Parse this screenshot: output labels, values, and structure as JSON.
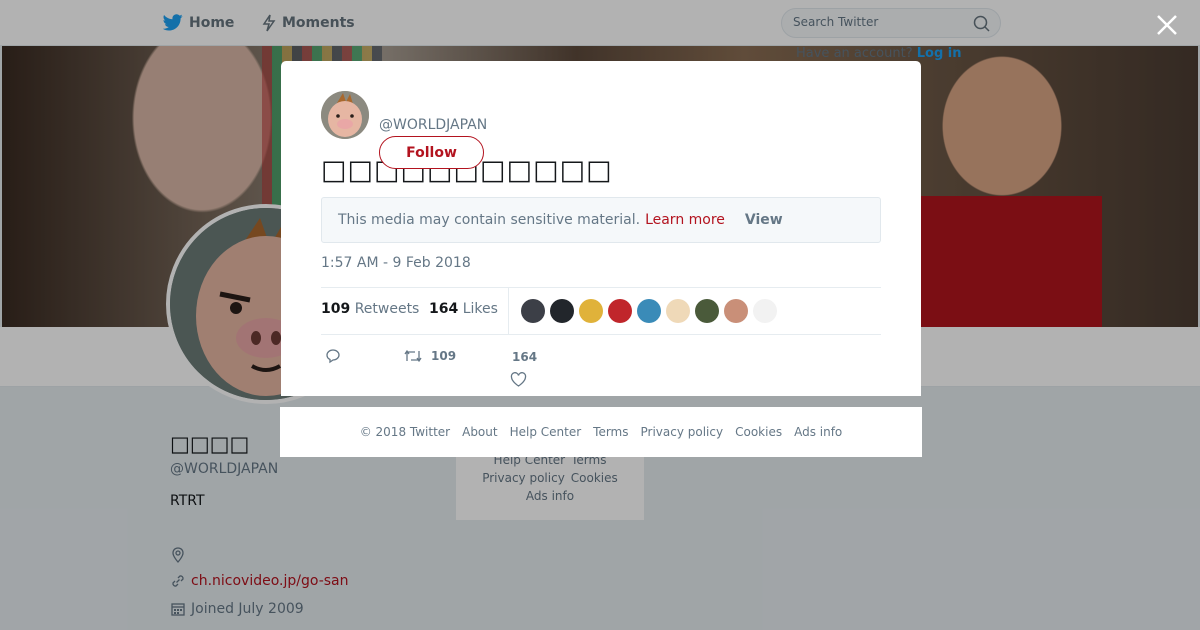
{
  "topbar": {
    "home_label": "Home",
    "moments_label": "Moments",
    "search_placeholder": "Search Twitter"
  },
  "login_hint": {
    "text": "Have an account?",
    "link": "Log in"
  },
  "profile": {
    "name": "□□□□",
    "handle": "@WORLDJAPAN",
    "bio": "RTRT",
    "url": "ch.nicovideo.jp/go-san",
    "joined": "Joined July 2009"
  },
  "side_footer": {
    "row1": [
      "Help Center",
      "Terms"
    ],
    "row2": [
      "Privacy policy",
      "Cookies"
    ],
    "row3": [
      "Ads info"
    ]
  },
  "tweet": {
    "handle": "@WORLDJAPAN",
    "follow_label": "Follow",
    "text": "□□□□□□□□□□□",
    "sensitive_text": "This media may contain sensitive material.",
    "learn_more": "Learn more",
    "view_label": "View",
    "timestamp": "1:57 AM - 9 Feb 2018",
    "retweets_count": "109",
    "retweets_label": "Retweets",
    "likes_count": "164",
    "likes_label": "Likes",
    "action_retweet_count": "109",
    "action_like_count": "164",
    "liker_colors": [
      "#3c3f47",
      "#22262b",
      "#e0b23a",
      "#c0262b",
      "#3a8bb8",
      "#efd9b8",
      "#4a5a3a",
      "#c98f78",
      "#f2f2f2"
    ]
  },
  "modal_footer": {
    "copyright": "© 2018 Twitter",
    "about": "About",
    "help": "Help Center",
    "terms": "Terms",
    "privacy": "Privacy policy",
    "cookies": "Cookies",
    "ads": "Ads info"
  },
  "colors": {
    "accent": "#b3131f",
    "twitter_blue": "#1da1f2",
    "muted": "#657786"
  }
}
